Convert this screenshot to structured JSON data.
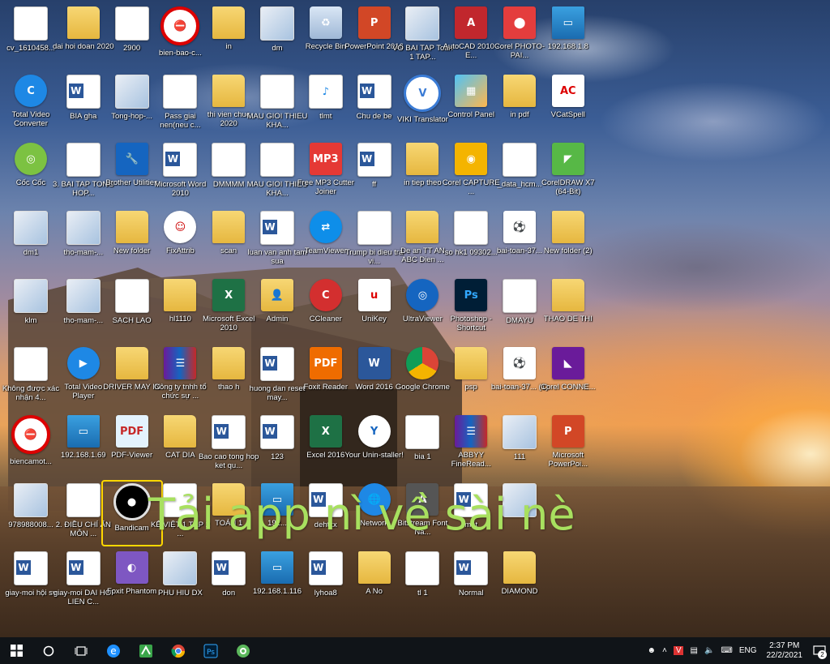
{
  "desktop_icons": [
    {
      "label": "cv_1610458...",
      "type": "doc"
    },
    {
      "label": "dai hoi doan 2020",
      "type": "folder"
    },
    {
      "label": "2900",
      "type": "doc"
    },
    {
      "label": "bien-bao-c...",
      "type": "sign"
    },
    {
      "label": "in",
      "type": "folder"
    },
    {
      "label": "dm",
      "type": "img"
    },
    {
      "label": "Recycle Bin",
      "type": "bin"
    },
    {
      "label": "PowerPoint 2016",
      "type": "ppt"
    },
    {
      "label": "VO BAI TAP Toan 1 TAP...",
      "type": "img"
    },
    {
      "label": "AutoCAD 2010 - E...",
      "type": "acad"
    },
    {
      "label": "Corel PHOTO-PAI...",
      "type": "corel"
    },
    {
      "label": "192.168.1.8",
      "type": "pc"
    },
    {
      "label": "Total Video Converter",
      "type": "tvc"
    },
    {
      "label": "BIA gha",
      "type": "word"
    },
    {
      "label": "Tong-hop-...",
      "type": "img"
    },
    {
      "label": "Pass giai nen(neu c...",
      "type": "doc"
    },
    {
      "label": "thi vien chuc 2020",
      "type": "folder"
    },
    {
      "label": "MAU GIOI THIEU KHA...",
      "type": "doc"
    },
    {
      "label": "tlmt",
      "type": "mp3"
    },
    {
      "label": "Chu de be",
      "type": "word"
    },
    {
      "label": "VIKI Translator",
      "type": "viki"
    },
    {
      "label": "Control Panel",
      "type": "cp"
    },
    {
      "label": "in pdf",
      "type": "folder"
    },
    {
      "label": "VCatSpell",
      "type": "vcat"
    },
    {
      "label": "Cốc Cốc",
      "type": "coccoc"
    },
    {
      "label": "3. BAI TAP TONG HOP...",
      "type": "doc"
    },
    {
      "label": "Brother Utilities",
      "type": "brother"
    },
    {
      "label": "Microsoft Word 2010",
      "type": "word"
    },
    {
      "label": "DMMMM",
      "type": "doc"
    },
    {
      "label": "MAU GIOI THIEU KHA...",
      "type": "doc"
    },
    {
      "label": "Free MP3 Cutter Joiner",
      "type": "mp3cut"
    },
    {
      "label": "ff",
      "type": "word"
    },
    {
      "label": "in tiep theo",
      "type": "folder"
    },
    {
      "label": "Corel CAPTURE ...",
      "type": "corel2"
    },
    {
      "label": "_data_hcm...",
      "type": "doc"
    },
    {
      "label": "CorelDRAW X7 (64-Bit)",
      "type": "coreldraw"
    },
    {
      "label": "dm1",
      "type": "img"
    },
    {
      "label": "tho-mam-...",
      "type": "img"
    },
    {
      "label": "New folder",
      "type": "folder"
    },
    {
      "label": "FixAttrib",
      "type": "fix"
    },
    {
      "label": "scan",
      "type": "folder"
    },
    {
      "label": "luan van anh tam sua",
      "type": "word"
    },
    {
      "label": "TeamViewer",
      "type": "teamviewer"
    },
    {
      "label": "Trump bi dieu tra vi...",
      "type": "doc"
    },
    {
      "label": "De an TT AN ABC Dien ...",
      "type": "folder"
    },
    {
      "label": "so hk1 09302...",
      "type": "doc"
    },
    {
      "label": "bai-toan-37...",
      "type": "ball"
    },
    {
      "label": "New folder (2)",
      "type": "folder"
    },
    {
      "label": "klm",
      "type": "img"
    },
    {
      "label": "tho-mam-...",
      "type": "img"
    },
    {
      "label": "SACH LAO",
      "type": "doc"
    },
    {
      "label": "hl1110",
      "type": "folder"
    },
    {
      "label": "Microsoft Excel 2010",
      "type": "excel"
    },
    {
      "label": "Admin",
      "type": "admin"
    },
    {
      "label": "CCleaner",
      "type": "ccleaner"
    },
    {
      "label": "UniKey",
      "type": "unikey"
    },
    {
      "label": "UltraViewer",
      "type": "ultra"
    },
    {
      "label": "Photoshop - Shortcut",
      "type": "ps"
    },
    {
      "label": "DMAYU",
      "type": "doc"
    },
    {
      "label": "THAO DE THI",
      "type": "folder"
    },
    {
      "label": "Không được xác nhận 4...",
      "type": "doc"
    },
    {
      "label": "Total Video Player",
      "type": "tvp"
    },
    {
      "label": "DRIVER MAY IN",
      "type": "folder"
    },
    {
      "label": "Công ty tnhh tổ chức sự ...",
      "type": "rar"
    },
    {
      "label": "thao h",
      "type": "folder"
    },
    {
      "label": "huong dan reset may...",
      "type": "word"
    },
    {
      "label": "Foxit Reader",
      "type": "foxit"
    },
    {
      "label": "Word 2016",
      "type": "word16"
    },
    {
      "label": "Google Chrome",
      "type": "chrome"
    },
    {
      "label": "psp",
      "type": "folder"
    },
    {
      "label": "bai-toan-37... (1)",
      "type": "ball"
    },
    {
      "label": "Corel CONNE...",
      "type": "corelconn"
    },
    {
      "label": "biencamot...",
      "type": "sign"
    },
    {
      "label": "192.168.1.69",
      "type": "pc"
    },
    {
      "label": "PDF-Viewer",
      "type": "pdfv"
    },
    {
      "label": "CAT DIA",
      "type": "folder"
    },
    {
      "label": "Bao cao tong hop ket qu...",
      "type": "word"
    },
    {
      "label": "123",
      "type": "word"
    },
    {
      "label": "Excel 2016",
      "type": "excel"
    },
    {
      "label": "Your Unin-staller!",
      "type": "uninst"
    },
    {
      "label": "bia 1",
      "type": "doc"
    },
    {
      "label": "ABBYY FineRead...",
      "type": "rar"
    },
    {
      "label": "111",
      "type": "img"
    },
    {
      "label": "Microsoft PowerPoi...",
      "type": "ppt"
    },
    {
      "label": "978988008...",
      "type": "img"
    },
    {
      "label": "2. ĐIỀU CHỈ ẤN MÔN ...",
      "type": "doc"
    },
    {
      "label": "Bandicam",
      "type": "bandicam"
    },
    {
      "label": "KẾ VIỆT 1 TẬP 2 ...",
      "type": "doc"
    },
    {
      "label": "TOÁN 1",
      "type": "folder"
    },
    {
      "label": "192...",
      "type": "pc"
    },
    {
      "label": "dehtxx",
      "type": "word"
    },
    {
      "label": "Network",
      "type": "network"
    },
    {
      "label": "Bitstream Font Na...",
      "type": "font"
    },
    {
      "label": "mat",
      "type": "word"
    },
    {
      "label": "",
      "type": "img"
    },
    {
      "label": "",
      "type": "none"
    },
    {
      "label": "giay-moi hội sv",
      "type": "word"
    },
    {
      "label": "giay-moi DAI HOI LIEN C...",
      "type": "word"
    },
    {
      "label": "Foxit Phantom",
      "type": "phantom"
    },
    {
      "label": "PHU HIU DX",
      "type": "img"
    },
    {
      "label": "don",
      "type": "word"
    },
    {
      "label": "192.168.1.116",
      "type": "pc"
    },
    {
      "label": "lyhoa8",
      "type": "word"
    },
    {
      "label": "A No",
      "type": "folder"
    },
    {
      "label": "tl 1",
      "type": "doc"
    },
    {
      "label": "Normal",
      "type": "word"
    },
    {
      "label": "DIAMOND",
      "type": "folder"
    },
    {
      "label": "",
      "type": "none"
    }
  ],
  "overlay": {
    "text": "Tải app nì về sài nè",
    "color": "#a8e05f"
  },
  "taskbar": {
    "start_icon": "windows-icon",
    "search_icon": "cortana-circle-icon",
    "taskview_icon": "task-view-icon",
    "pinned": [
      "edge-icon",
      "corel-icon",
      "chrome-icon",
      "photoshop-icon",
      "coccoc-icon"
    ],
    "tray": {
      "language": "ENG",
      "time": "2:37 PM",
      "date": "22/2/2021",
      "notifications": "2"
    }
  },
  "colors": {
    "taskbar": "#101418",
    "highlight": "#ffd700"
  }
}
